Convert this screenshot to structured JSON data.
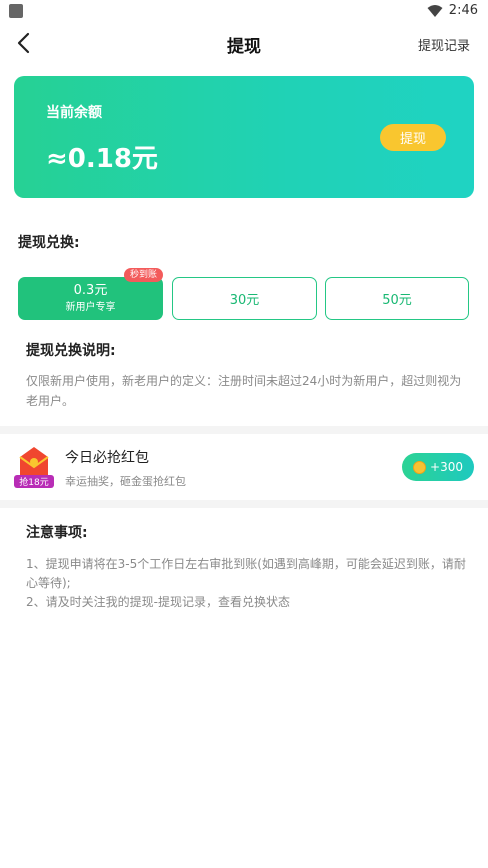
{
  "status_bar": {
    "time": "2:46"
  },
  "nav": {
    "title": "提现",
    "right_link": "提现记录"
  },
  "balance": {
    "label": "当前余额",
    "value": "≈0.18元",
    "withdraw_button": "提现"
  },
  "exchange": {
    "title": "提现兑换:",
    "options": [
      {
        "amount": "0.3元",
        "sub": "新用户专享",
        "badge": "秒到账",
        "selected": true
      },
      {
        "amount": "30元"
      },
      {
        "amount": "50元"
      }
    ]
  },
  "description": {
    "title": "提现兑换说明:",
    "text": "仅限新用户使用，新老用户的定义：注册时间未超过24小时为新用户，超过则视为老用户。"
  },
  "red_packet": {
    "icon_label": "抢18元",
    "title": "今日必抢红包",
    "subtitle": "幸运抽奖，砸金蛋抢红包",
    "button": "+300"
  },
  "notes": {
    "title": "注意事项:",
    "line1": "1、提现申请将在3-5个工作日左右审批到账(如遇到高峰期，可能会延迟到账，请耐心等待);",
    "line2": "2、请及时关注我的提现-提现记录，查看兑换状态"
  },
  "colors": {
    "primary_green": "#21c27c",
    "card_gradient_start": "#26d194",
    "card_gradient_end": "#1fd3c3",
    "withdraw_button": "#f9c62f",
    "badge_red": "#f35b5b"
  }
}
